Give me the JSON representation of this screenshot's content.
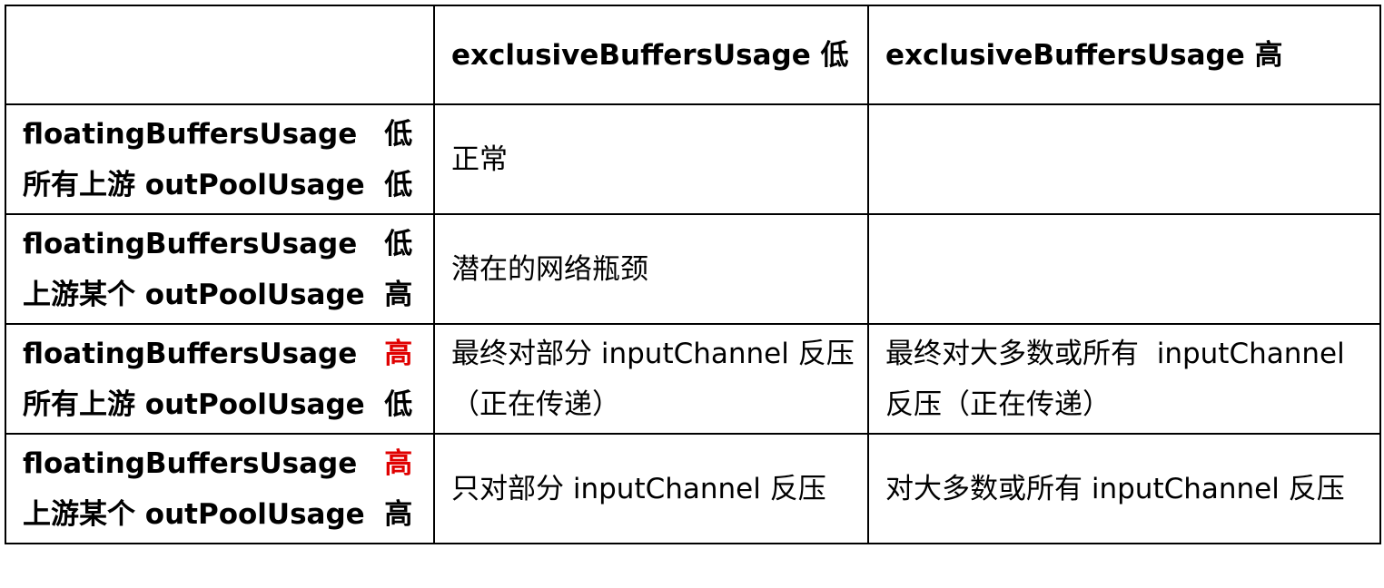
{
  "table": {
    "header": {
      "corner": "",
      "col1": "exclusiveBuffersUsage 低",
      "col2": "exclusiveBuffersUsage 高"
    },
    "rows": [
      {
        "line1_label": "floatingBuffersUsage",
        "line1_level": "低",
        "line1_level_color": "#000000",
        "line2": "所有上游 outPoolUsage  低",
        "col1": "正常",
        "col2": ""
      },
      {
        "line1_label": "floatingBuffersUsage",
        "line1_level": "低",
        "line1_level_color": "#000000",
        "line2": "上游某个 outPoolUsage  高",
        "col1": "潜在的网络瓶颈",
        "col2": ""
      },
      {
        "line1_label": "floatingBuffersUsage",
        "line1_level": "高",
        "line1_level_color": "#e00000",
        "line2": "所有上游 outPoolUsage  低",
        "col1_line1": "最终对部分 inputChannel 反压",
        "col1_line2": "（正在传递）",
        "col2_line1": "最终对大多数或所有  inputChannel",
        "col2_line2": "反压（正在传递）"
      },
      {
        "line1_label": "floatingBuffersUsage",
        "line1_level": "高",
        "line1_level_color": "#e00000",
        "line2": "上游某个 outPoolUsage  高",
        "col1": "只对部分 inputChannel 反压",
        "col2": "对大多数或所有 inputChannel 反压"
      }
    ]
  }
}
